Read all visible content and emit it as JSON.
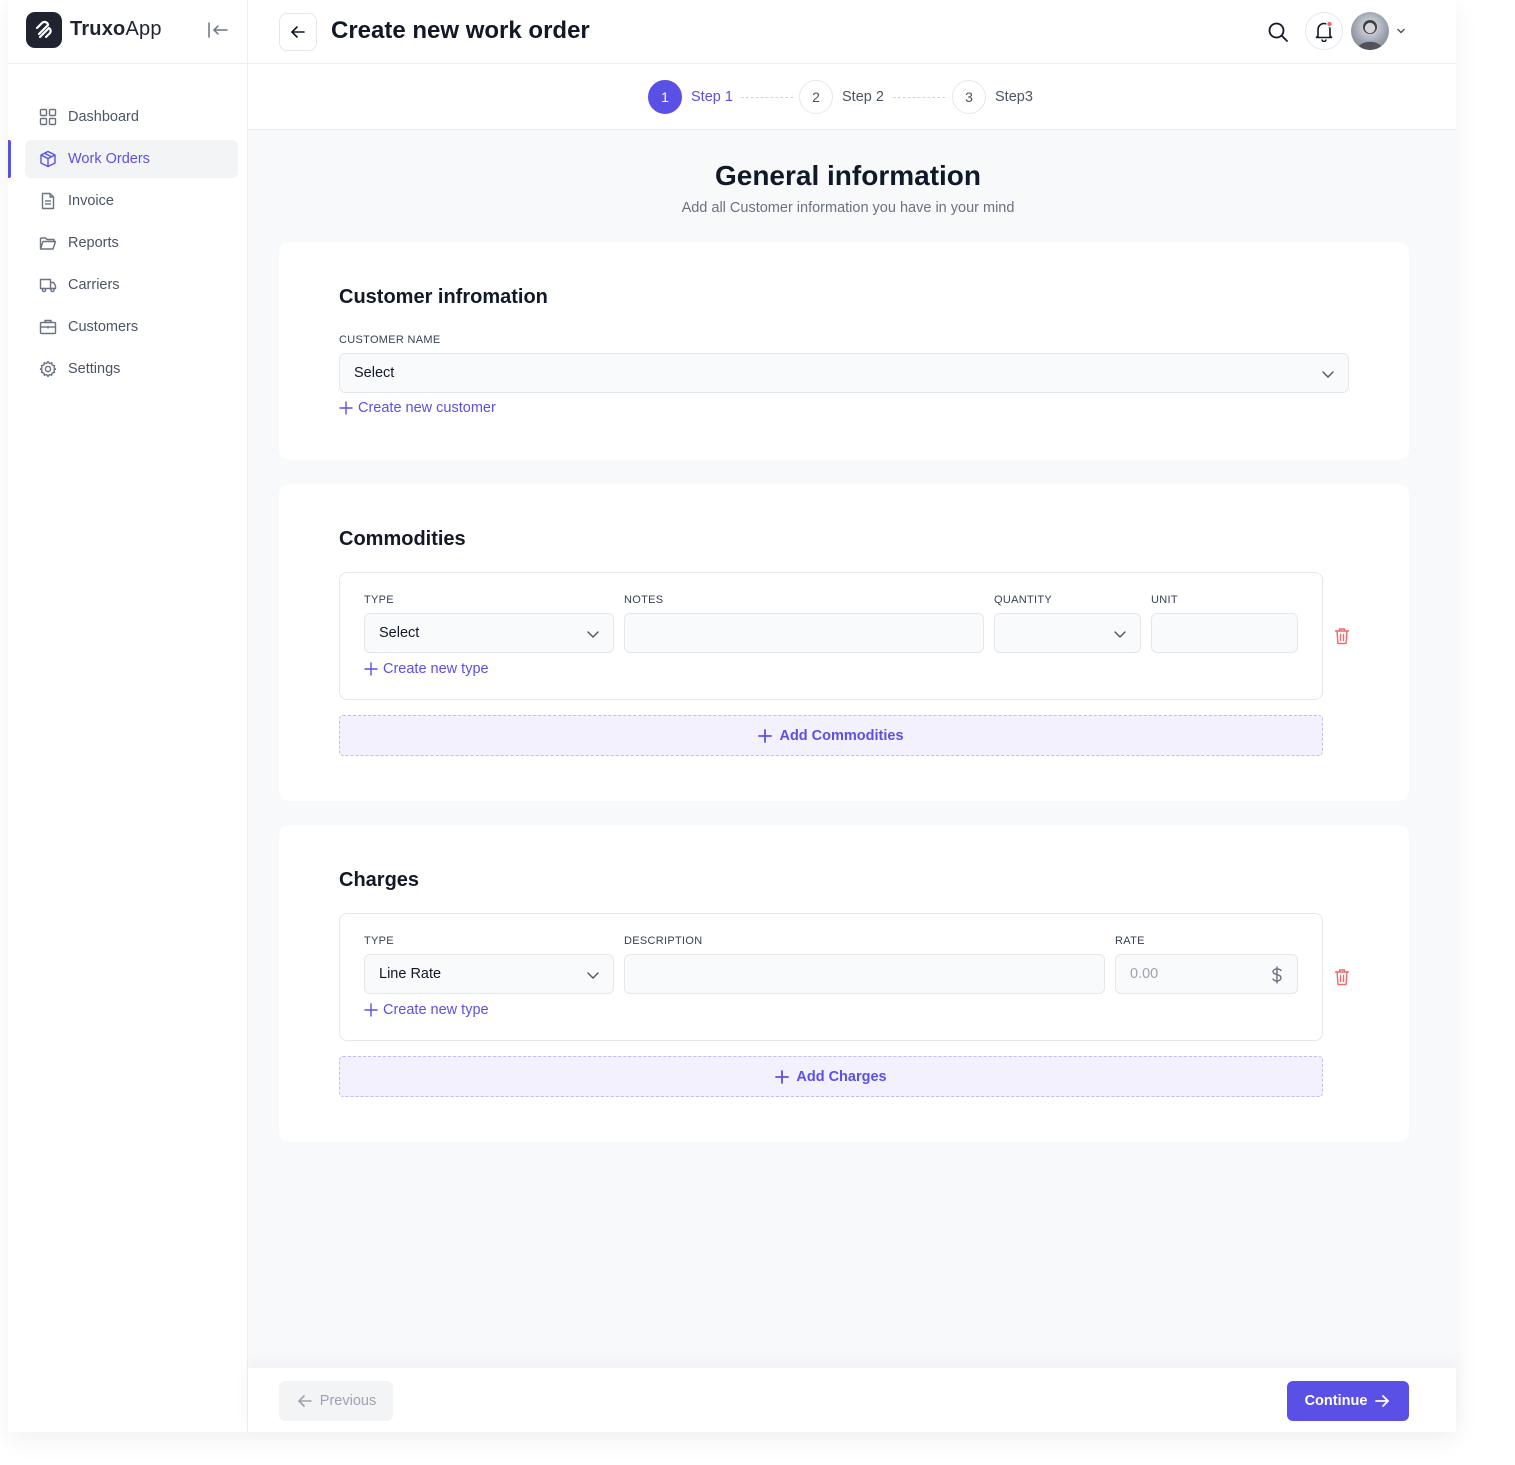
{
  "brand": {
    "name_bold": "Truxo",
    "name_light": "App"
  },
  "sidebar": {
    "items": [
      {
        "label": "Dashboard",
        "icon": "grid-icon"
      },
      {
        "label": "Work Orders",
        "icon": "box-icon",
        "active": true
      },
      {
        "label": "Invoice",
        "icon": "document-icon"
      },
      {
        "label": "Reports",
        "icon": "folder-icon"
      },
      {
        "label": "Carriers",
        "icon": "truck-icon"
      },
      {
        "label": "Customers",
        "icon": "briefcase-icon"
      },
      {
        "label": "Settings",
        "icon": "gear-icon"
      }
    ]
  },
  "header": {
    "title": "Create new work order"
  },
  "stepper": {
    "steps": [
      {
        "number": "1",
        "label": "Step 1",
        "active": true
      },
      {
        "number": "2",
        "label": "Step 2"
      },
      {
        "number": "3",
        "label": "Step3"
      }
    ]
  },
  "main": {
    "heading": "General information",
    "subheading": "Add all Customer information you have in your mind",
    "customer": {
      "title": "Customer infromation",
      "name_label": "CUSTOMER NAME",
      "name_value": "Select",
      "create_link": "Create new customer"
    },
    "commodities": {
      "title": "Commodities",
      "type_label": "TYPE",
      "type_value": "Select",
      "notes_label": "NOTES",
      "notes_value": "",
      "quantity_label": "QUANTITY",
      "quantity_value": "",
      "unit_label": "UNIT",
      "unit_value": "",
      "create_link": "Create new type",
      "add_button": "Add Commodities"
    },
    "charges": {
      "title": "Charges",
      "type_label": "TYPE",
      "type_value": "Line Rate",
      "description_label": "DESCRIPTION",
      "description_value": "",
      "rate_label": "RATE",
      "rate_placeholder": "0.00",
      "create_link": "Create new type",
      "add_button": "Add Charges"
    }
  },
  "footer": {
    "previous_label": "Previous",
    "continue_label": "Continue"
  },
  "colors": {
    "accent": "#5b50e6",
    "danger": "#ef6a6a",
    "brand_dark": "#1f2430"
  }
}
